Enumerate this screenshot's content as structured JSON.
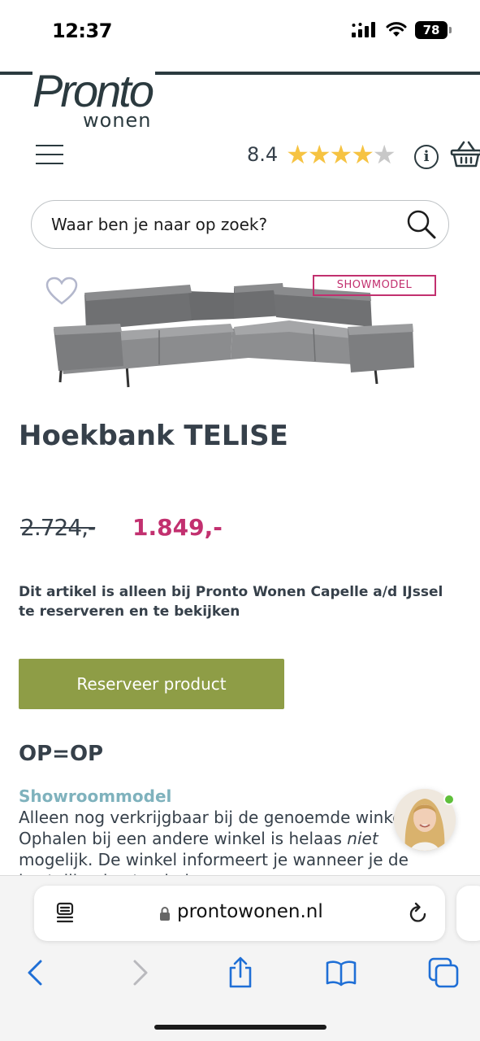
{
  "status_bar": {
    "time": "12:37",
    "battery": "78",
    "icons": [
      "cellular-signal-icon",
      "wifi-icon",
      "battery-icon"
    ]
  },
  "brand": {
    "logo_main": "Pronto",
    "logo_sub": "wonen",
    "color": "#2b3a3f"
  },
  "header": {
    "rating_score": "8.4",
    "rating_stars": 4,
    "rating_stars_max": 5,
    "icons": [
      "menu-icon",
      "star-icon",
      "info-icon",
      "basket-icon"
    ]
  },
  "search": {
    "placeholder": "Waar ben je naar op zoek?",
    "value": ""
  },
  "product": {
    "badge": "SHOWMODEL",
    "title": "Hoekbank TELISE",
    "old_price": "2.724,-",
    "new_price": "1.849,-",
    "availability": "Dit artikel is alleen bij Pronto Wonen Capelle a/d IJssel te reserveren en te bekijken",
    "reserve_button": "Reserveer product",
    "section_heading": "OP=OP",
    "showroom_title": "Showroommodel",
    "showroom_text_1": "Alleen nog verkrijgbaar bij de genoemde winkel. Ophalen bij een andere winkel is helaas ",
    "showroom_text_em": "niet",
    "showroom_text_2": " mogelijk. De winkel informeert je wanneer je de bestelling kunt ophalen."
  },
  "colors": {
    "accent_pink": "#c2306f",
    "button_green": "#8e9d46",
    "teal": "#7fb2bd",
    "text": "#36404a",
    "star": "#f6c342"
  },
  "browser": {
    "url": "prontowonen.nl",
    "icons": [
      "reader-icon",
      "lock-icon",
      "reload-icon",
      "back-icon",
      "forward-icon",
      "share-icon",
      "bookmarks-icon",
      "tabs-icon"
    ]
  }
}
